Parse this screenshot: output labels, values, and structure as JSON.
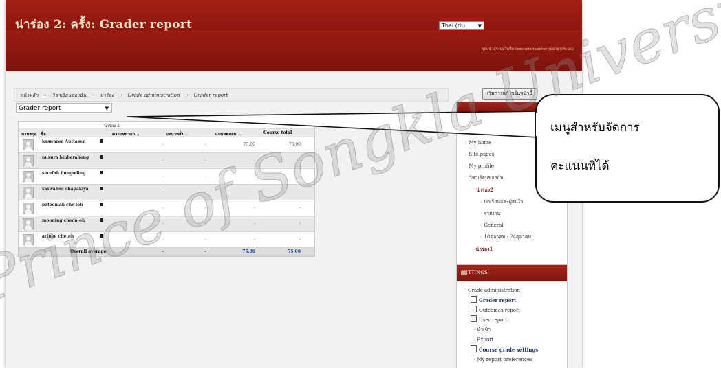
{
  "header": {
    "site_title": "น่าร่อง 2: ครั้ง: Grader report",
    "language": "Thai (th)",
    "login_info": "คุณเข้าสู่ระบบในชื่อ teachers teacher (ออกจากระบบ)"
  },
  "breadcrumb": [
    "หน้าหลัก",
    "วิชาเรียนของฉัน",
    "น่าร้อง",
    "Grade administration",
    "Grader report"
  ],
  "edit_button": "เริ่มการแก้ไขในหน้านี้",
  "report_selector": "Grader report",
  "grade_table": {
    "category_label": "น่าร่อง 2",
    "columns": {
      "surname": "นามสกุล",
      "firstname": "ชื่อ",
      "item1": "ความหมายก...",
      "item2": "บทบาทสั่ง...",
      "item3": "แบบทดสอบ...",
      "total": "Course total"
    },
    "rows": [
      {
        "name": "kaswaree Auttasen",
        "c1": "-",
        "c2": "-",
        "c3": "75.00",
        "total": "75.00"
      },
      {
        "name": "nusura binberaheng",
        "c1": "-",
        "c2": "-",
        "c3": "-",
        "total": "-"
      },
      {
        "name": "sarefah bungoding",
        "c1": "-",
        "c2": "-",
        "c3": "-",
        "total": "-"
      },
      {
        "name": "saswanee chapakiya",
        "c1": "-",
        "c2": "-",
        "c3": "-",
        "total": "-"
      },
      {
        "name": "pateemah che'loh",
        "c1": "-",
        "c2": "-",
        "c3": "-",
        "total": "-"
      },
      {
        "name": "mooning cheda-oh",
        "c1": "-",
        "c2": "-",
        "c3": "-",
        "total": "-"
      },
      {
        "name": "arinee cheteh",
        "c1": "-",
        "c2": "-",
        "c3": "-",
        "total": "-"
      }
    ],
    "overall": {
      "label": "Overall average",
      "c1": "-",
      "c2": "-",
      "c3": "75.00",
      "total": "75.00"
    }
  },
  "navigation": {
    "items": [
      "My home",
      "Site pages",
      "My profile",
      "วิชาเรียนของฉัน",
      "น่าร่อง2",
      "ปักเรียนและผู้สนใจ",
      "รายงาน",
      "General",
      "18ตุลาคม - 24ตุลาคม",
      "น่าร่อง1"
    ]
  },
  "settings": {
    "title": "SETTINGS",
    "items": [
      "Grade administration",
      "Grader report",
      "Outcomes report",
      "User report",
      "นำเข้า",
      "Export",
      "Course grade settings",
      "My report preferences"
    ]
  },
  "callout": {
    "line1": "เมนูสำหรับจัดการ",
    "line2": "คะแนนที่ได้"
  },
  "watermark": "Prince of Songkla University Pattani Campus"
}
